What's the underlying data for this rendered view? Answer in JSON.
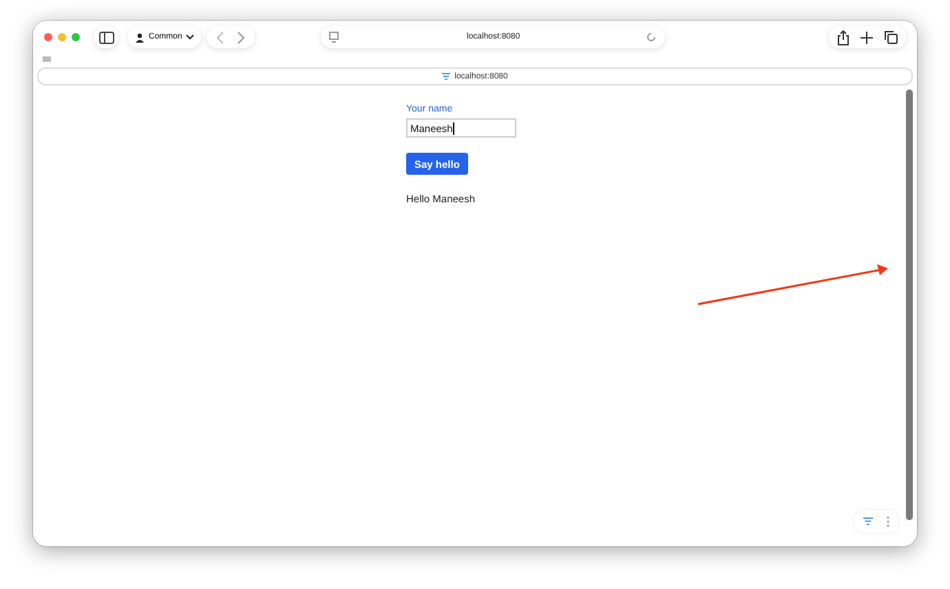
{
  "toolbar": {
    "profile": "Common",
    "address": "localhost:8080"
  },
  "page_bar": {
    "address": "localhost:8080"
  },
  "form": {
    "label": "Your name",
    "value": "Maneesh",
    "button": "Say hello"
  },
  "output": "Hello Maneesh"
}
